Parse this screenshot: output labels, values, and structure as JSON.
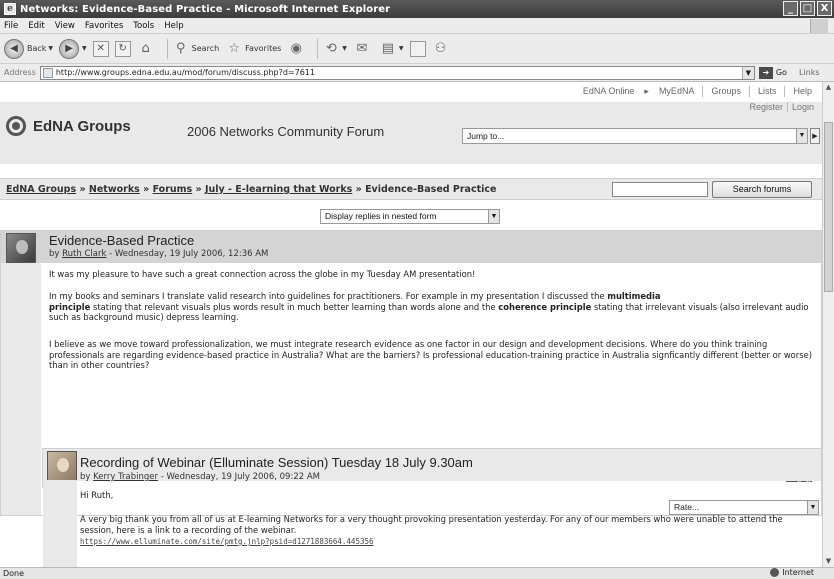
{
  "window": {
    "title": "Networks: Evidence-Based Practice - Microsoft Internet Explorer",
    "controls": [
      "_",
      "□",
      "X"
    ]
  },
  "menu": [
    "File",
    "Edit",
    "View",
    "Favorites",
    "Tools",
    "Help"
  ],
  "toolbar": {
    "back_label": "Back",
    "search_label": "Search",
    "favorites_label": "Favorites"
  },
  "address": {
    "label": "Address",
    "url": "http://www.groups.edna.edu.au/mod/forum/discuss.php?d=7611",
    "go_label": "Go",
    "links_label": "Links"
  },
  "topnav": {
    "edna_online": "EdNA Online",
    "myedna": "MyEdNA",
    "groups": "Groups",
    "lists": "Lists",
    "help": "Help"
  },
  "header": {
    "logo_text": "EdNA Groups",
    "forum_title": "2006 Networks Community Forum",
    "register": "Register",
    "login": "Login",
    "jump_placeholder": "Jump to..."
  },
  "breadcrumb": {
    "items": [
      "EdNA Groups",
      "Networks",
      "Forums",
      "July - E-learning that Works"
    ],
    "current": "Evidence-Based Practice",
    "separator": "»"
  },
  "search": {
    "button_label": "Search forums"
  },
  "display_mode": "Display replies in nested form",
  "post1": {
    "subject": "Evidence-Based Practice",
    "by_prefix": "by",
    "author": "Ruth Clark",
    "date": "- Wednesday, 19 July 2006, 12:36 AM",
    "p1": "It was my pleasure to have such a great connection across the globe in my Tuesday AM presentation!",
    "p2_a": "In my books and seminars I  translate valid research into guidelines for practitioners.  For example in my presentation I discussed the ",
    "p2_b1": "multimedia",
    "p2_c_line2_bold": "principle",
    "p2_c": " stating that relevant visuals plus words result in much better learning than words alone and the ",
    "p2_b2": "coherence principle",
    "p2_d": " stating that irrelevant visuals (also irrelevant audio such as background music) depress learning.",
    "p3": "I believe as we move toward professionalization, we must integrate research evidence as one factor in our design and development decisions. Where do you think training professionals are regarding evidence-based practice in Australia?  What are the barriers? Is professional education-training practice in Australia signficantly different (better or worse) than in other countries?",
    "reply": "Reply",
    "rate": "Rate..."
  },
  "post2": {
    "subject": "Recording of Webinar (Elluminate Session) Tuesday 18 July 9.30am",
    "by_prefix": "by",
    "author": "Kerry Trabinger",
    "date": "- Wednesday, 19 July 2006, 09:22 AM",
    "greeting": "Hi Ruth,",
    "body": "A very big thank you from all of us at E-learning Networks for a very thought provoking presentation yesterday. For any of our members who were unable to attend the session, here is a link to a recording of the webinar.",
    "url": "https://www.elluminate.com/site/pmtg.jnlp?psid=d1271883664.445356"
  },
  "status": {
    "left": "Done",
    "zone": "Internet"
  }
}
